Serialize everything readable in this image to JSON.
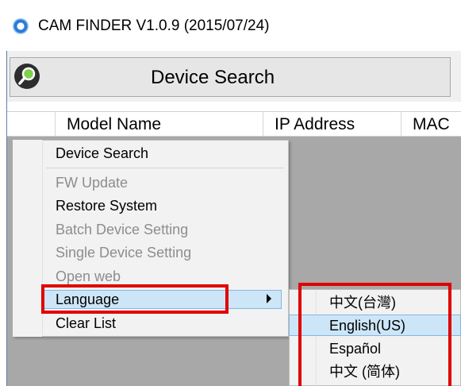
{
  "window": {
    "title": "CAM FINDER V1.0.9 (2015/07/24)",
    "app_icon": "webcam-icon"
  },
  "toolbar": {
    "search_label": "Device Search",
    "search_icon": "magnifier-icon"
  },
  "table": {
    "columns": [
      "",
      "Model Name",
      "IP Address",
      "MAC"
    ]
  },
  "context_menu": {
    "items": [
      {
        "label": "Device Search",
        "enabled": true
      },
      {
        "label": "FW Update",
        "enabled": false
      },
      {
        "label": "Restore System",
        "enabled": true
      },
      {
        "label": "Batch Device Setting",
        "enabled": false
      },
      {
        "label": "Single Device Setting",
        "enabled": false
      },
      {
        "label": "Open web",
        "enabled": false
      },
      {
        "label": "Language",
        "enabled": true,
        "has_submenu": true,
        "highlighted": true
      },
      {
        "label": "Clear List",
        "enabled": true
      }
    ]
  },
  "language_submenu": {
    "items": [
      {
        "label": "中文(台灣)"
      },
      {
        "label": "English(US)",
        "highlighted": true
      },
      {
        "label": "Español"
      },
      {
        "label": "中文 (简体)"
      }
    ]
  },
  "colors": {
    "annotation_red": "#e00000",
    "highlight": "#cde6f7",
    "grid_background": "#a8a8a8"
  }
}
